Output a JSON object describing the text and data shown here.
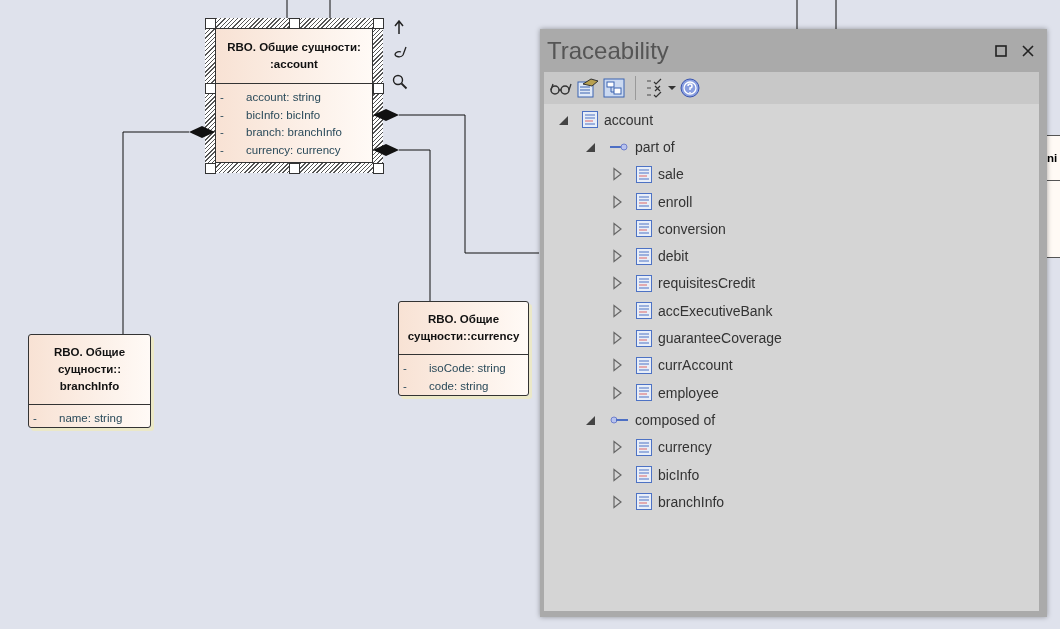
{
  "diagram": {
    "classes": [
      {
        "title_lines": [
          "RBO. Общие сущности:",
          ":account"
        ],
        "selected": true,
        "attributes": [
          {
            "visibility": "-",
            "text": "account: string"
          },
          {
            "visibility": "-",
            "text": "bicInfo: bicInfo"
          },
          {
            "visibility": "-",
            "text": "branch: branchInfo"
          },
          {
            "visibility": "-",
            "text": "currency: currency"
          }
        ]
      },
      {
        "title_lines": [
          "RBO. Общие",
          "сущности::",
          "branchInfo"
        ],
        "selected": false,
        "attributes": [
          {
            "visibility": "-",
            "text": "name: string"
          }
        ]
      },
      {
        "title_lines": [
          "RBO. Общие",
          "сущности::currency"
        ],
        "selected": false,
        "attributes": [
          {
            "visibility": "-",
            "text": "isoCode: string"
          },
          {
            "visibility": "-",
            "text": "code: string"
          }
        ]
      }
    ],
    "partial_class": {
      "title": "ni"
    }
  },
  "panel": {
    "title": "Traceability",
    "tree": [
      {
        "label": "account",
        "kind": "class",
        "expanded": true,
        "children": [
          {
            "label": "part of",
            "kind": "part_of",
            "expanded": true,
            "children": [
              {
                "label": "sale",
                "kind": "class",
                "expanded": false
              },
              {
                "label": "enroll",
                "kind": "class",
                "expanded": false
              },
              {
                "label": "conversion",
                "kind": "class",
                "expanded": false
              },
              {
                "label": "debit",
                "kind": "class",
                "expanded": false
              },
              {
                "label": "requisitesCredit",
                "kind": "class",
                "expanded": false
              },
              {
                "label": "accExecutiveBank",
                "kind": "class",
                "expanded": false
              },
              {
                "label": "guaranteeCoverage",
                "kind": "class",
                "expanded": false
              },
              {
                "label": "currAccount",
                "kind": "class",
                "expanded": false
              },
              {
                "label": "employee",
                "kind": "class",
                "expanded": false
              }
            ]
          },
          {
            "label": "composed of",
            "kind": "composed_of",
            "expanded": true,
            "children": [
              {
                "label": "currency",
                "kind": "class",
                "expanded": false
              },
              {
                "label": "bicInfo",
                "kind": "class",
                "expanded": false
              },
              {
                "label": "branchInfo",
                "kind": "class",
                "expanded": false
              }
            ]
          }
        ]
      }
    ]
  }
}
